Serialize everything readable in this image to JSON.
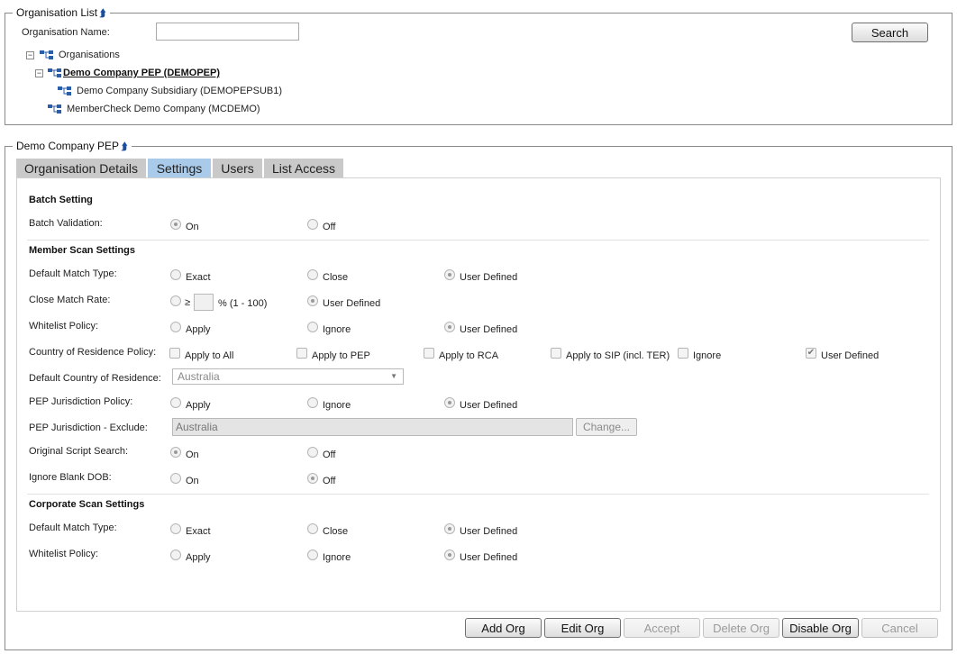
{
  "org_list": {
    "legend": "Organisation List",
    "name_label": "Organisation Name:",
    "name_value": "",
    "search_label": "Search",
    "tree": {
      "root": "Organisations",
      "items": [
        {
          "label": "Demo Company PEP (DEMOPEP)"
        },
        {
          "label": "Demo Company Subsidiary (DEMOPEPSUB1)"
        },
        {
          "label": "MemberCheck Demo Company (MCDEMO)"
        }
      ]
    }
  },
  "detail": {
    "legend": "Demo Company PEP",
    "tabs": [
      "Organisation Details",
      "Settings",
      "Users",
      "List Access"
    ],
    "active_tab": "Settings"
  },
  "settings": {
    "batch_title": "Batch Setting",
    "batch_validation": {
      "label": "Batch Validation:",
      "options": [
        "On",
        "Off"
      ],
      "selected": "On"
    },
    "member_title": "Member Scan Settings",
    "default_match": {
      "label": "Default Match Type:",
      "options": [
        "Exact",
        "Close",
        "User Defined"
      ],
      "selected": "User Defined"
    },
    "close_rate": {
      "label": "Close Match Rate:",
      "ge": "≥",
      "range": "% (1 - 100)",
      "user_defined": "User Defined",
      "selected": "User Defined"
    },
    "whitelist": {
      "label": "Whitelist Policy:",
      "options": [
        "Apply",
        "Ignore",
        "User Defined"
      ],
      "selected": "User Defined"
    },
    "country_policy": {
      "label": "Country of Residence Policy:",
      "options": [
        "Apply to All",
        "Apply to PEP",
        "Apply to RCA",
        "Apply to SIP (incl. TER)",
        "Ignore",
        "User Defined"
      ],
      "checked": "User Defined"
    },
    "default_country": {
      "label": "Default Country of Residence:",
      "value": "Australia"
    },
    "pep_jurisdiction": {
      "label": "PEP Jurisdiction Policy:",
      "options": [
        "Apply",
        "Ignore",
        "User Defined"
      ],
      "selected": "User Defined"
    },
    "pep_exclude": {
      "label": "PEP Jurisdiction - Exclude:",
      "value": "Australia",
      "change_label": "Change..."
    },
    "original_script": {
      "label": "Original Script Search:",
      "options": [
        "On",
        "Off"
      ],
      "selected": "On"
    },
    "ignore_dob": {
      "label": "Ignore Blank DOB:",
      "options": [
        "On",
        "Off"
      ],
      "selected": "Off"
    },
    "corporate_title": "Corporate Scan Settings",
    "corp_default_match": {
      "label": "Default Match Type:",
      "options": [
        "Exact",
        "Close",
        "User Defined"
      ],
      "selected": "User Defined"
    },
    "corp_whitelist": {
      "label": "Whitelist Policy:",
      "options": [
        "Apply",
        "Ignore",
        "User Defined"
      ],
      "selected": "User Defined"
    }
  },
  "actions": {
    "add": "Add Org",
    "edit": "Edit Org",
    "accept": "Accept",
    "delete": "Delete Org",
    "disable": "Disable Org",
    "cancel": "Cancel"
  },
  "colors": {
    "active_tab": "#a9cbe9",
    "tab": "#c9c9c9",
    "tree_icon": "#2a5ea8"
  }
}
